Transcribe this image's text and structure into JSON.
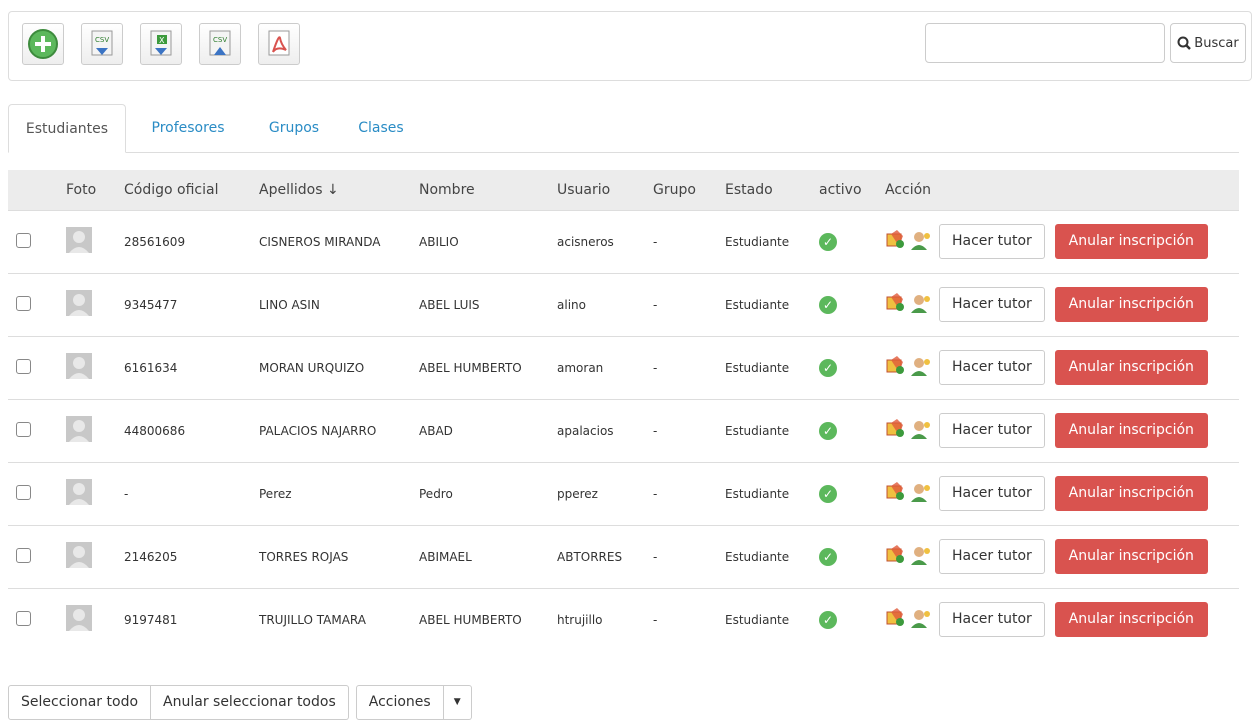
{
  "toolbar": {
    "icons": [
      "add-icon",
      "csv-export-icon",
      "excel-export-icon",
      "csv-import-icon",
      "pdf-icon"
    ],
    "search_placeholder": "",
    "search_label": "Buscar"
  },
  "tabs": [
    "Estudiantes",
    "Profesores",
    "Grupos",
    "Clases"
  ],
  "table": {
    "headers": [
      "",
      "Foto",
      "Código oficial",
      "Apellidos ↓",
      "Nombre",
      "Usuario",
      "Grupo",
      "Estado",
      "activo",
      "Acción"
    ],
    "rows": [
      {
        "codigo": "28561609",
        "apellidos": "CISNEROS MIRANDA",
        "nombre": "ABILIO",
        "usuario": "acisneros",
        "grupo": "-",
        "estado": "Estudiante"
      },
      {
        "codigo": "9345477",
        "apellidos": "LINO ASIN",
        "nombre": "ABEL LUIS",
        "usuario": "alino",
        "grupo": "-",
        "estado": "Estudiante"
      },
      {
        "codigo": "6161634",
        "apellidos": "MORAN URQUIZO",
        "nombre": "ABEL HUMBERTO",
        "usuario": "amoran",
        "grupo": "-",
        "estado": "Estudiante"
      },
      {
        "codigo": "44800686",
        "apellidos": "PALACIOS NAJARRO",
        "nombre": "ABAD",
        "usuario": "apalacios",
        "grupo": "-",
        "estado": "Estudiante"
      },
      {
        "codigo": "-",
        "apellidos": "Perez",
        "nombre": "Pedro",
        "usuario": "pperez",
        "grupo": "-",
        "estado": "Estudiante"
      },
      {
        "codigo": "2146205",
        "apellidos": "TORRES ROJAS",
        "nombre": "ABIMAEL",
        "usuario": "ABTORRES",
        "grupo": "-",
        "estado": "Estudiante"
      },
      {
        "codigo": "9197481",
        "apellidos": "TRUJILLO TAMARA",
        "nombre": "ABEL HUMBERTO",
        "usuario": "htrujillo",
        "grupo": "-",
        "estado": "Estudiante"
      }
    ],
    "tutor_label": "Hacer tutor",
    "anular_label": "Anular inscripción"
  },
  "bottom": {
    "select_all": "Seleccionar todo",
    "deselect_all": "Anular seleccionar todos",
    "actions": "Acciones"
  },
  "colors": {
    "accent": "#2a8cc5",
    "danger": "#d9534f",
    "success": "#5cb85c"
  }
}
